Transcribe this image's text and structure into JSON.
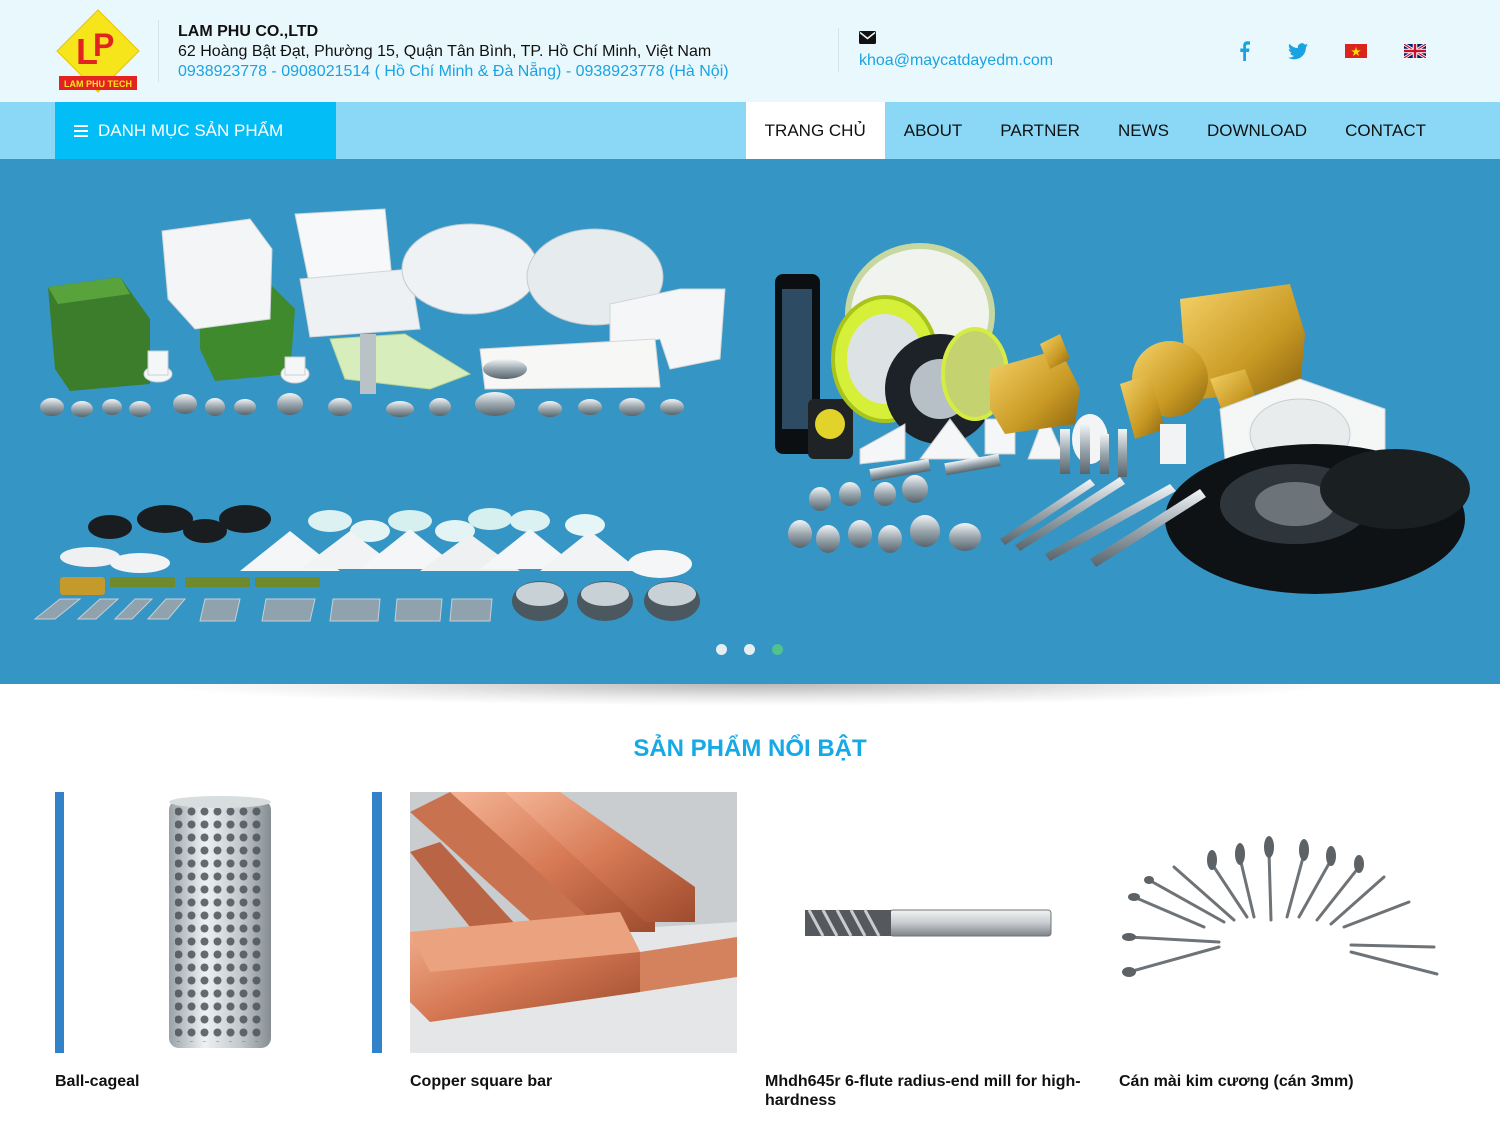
{
  "header": {
    "logo_text": "LAM PHU TECH",
    "company_name": "LAM PHU CO.,LTD",
    "address": "62 Hoàng Bật Đạt, Phường 15, Quận Tân Bình, TP. Hồ Chí Minh, Việt Nam",
    "phones": "0938923778 - 0908021514 ( Hồ Chí Minh & Đà Nẵng) - 0938923778 (Hà Nội)",
    "email": "khoa@maycatdayedm.com",
    "social": [
      "facebook-icon",
      "twitter-icon"
    ],
    "languages": [
      "Tiếng Việt",
      "English"
    ]
  },
  "nav": {
    "category_label": "DANH MỤC SẢN PHẨM",
    "items": [
      {
        "label": "TRANG CHỦ",
        "active": true
      },
      {
        "label": "ABOUT"
      },
      {
        "label": "PARTNER"
      },
      {
        "label": "NEWS"
      },
      {
        "label": "DOWNLOAD"
      },
      {
        "label": "CONTACT"
      }
    ]
  },
  "slider": {
    "slide_count": 3,
    "active_slide": 3
  },
  "featured": {
    "title": "SẢN PHẨM NỔI BẬT",
    "products": [
      {
        "name": "Ball-cageal"
      },
      {
        "name": "Copper square bar"
      },
      {
        "name": "Mhdh645r 6-flute radius-end mill for high-hardness"
      },
      {
        "name": "Cán mài kim cương (cán 3mm)"
      }
    ]
  },
  "colors": {
    "accent": "#15a9e6",
    "nav_bg": "#8ad8f6",
    "category_bg": "#03bdf6",
    "banner_bg": "#3595c4",
    "header_bg": "#e9f8fd"
  }
}
